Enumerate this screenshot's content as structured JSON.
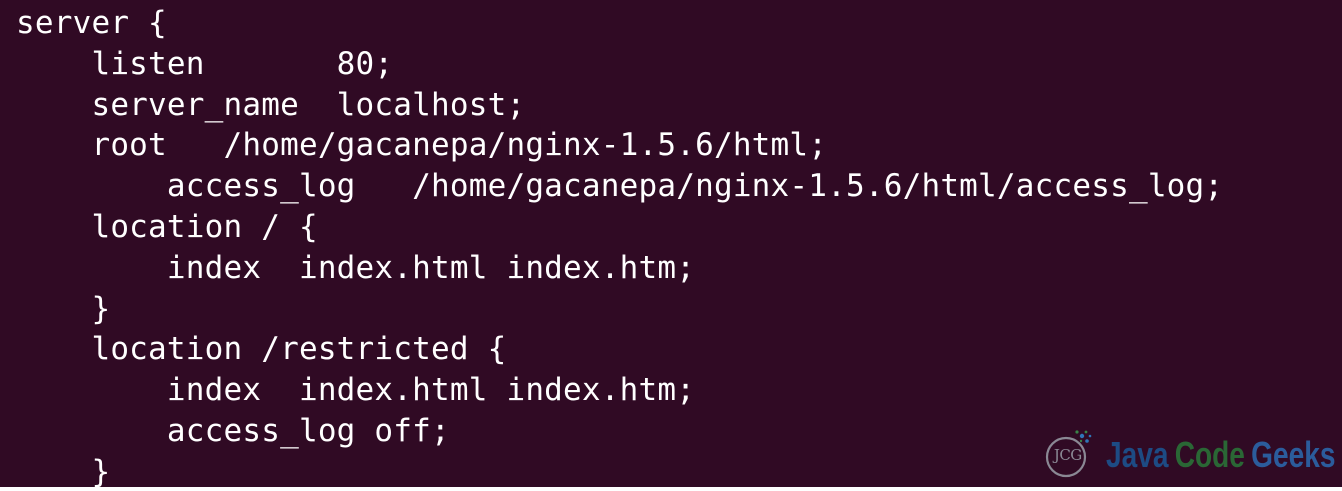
{
  "terminal": {
    "lines": [
      "server {",
      "    listen       80;",
      "    server_name  localhost;",
      "    root   /home/gacanepa/nginx-1.5.6/html;",
      "        access_log   /home/gacanepa/nginx-1.5.6/html/access_log;",
      "    location / {",
      "        index  index.html index.htm;",
      "    }",
      "    location /restricted {",
      "        index  index.html index.htm;",
      "        access_log off;",
      "    }"
    ],
    "background_color": "#300a24",
    "text_color": "#ffffff"
  },
  "watermark": {
    "logo_text": "JCG",
    "brand_word_1": "Java",
    "brand_word_2": "Code",
    "brand_word_3": "Geeks",
    "colors": {
      "java": "#1c4f8a",
      "code": "#2a6c36",
      "geeks": "#2b61a3"
    }
  }
}
